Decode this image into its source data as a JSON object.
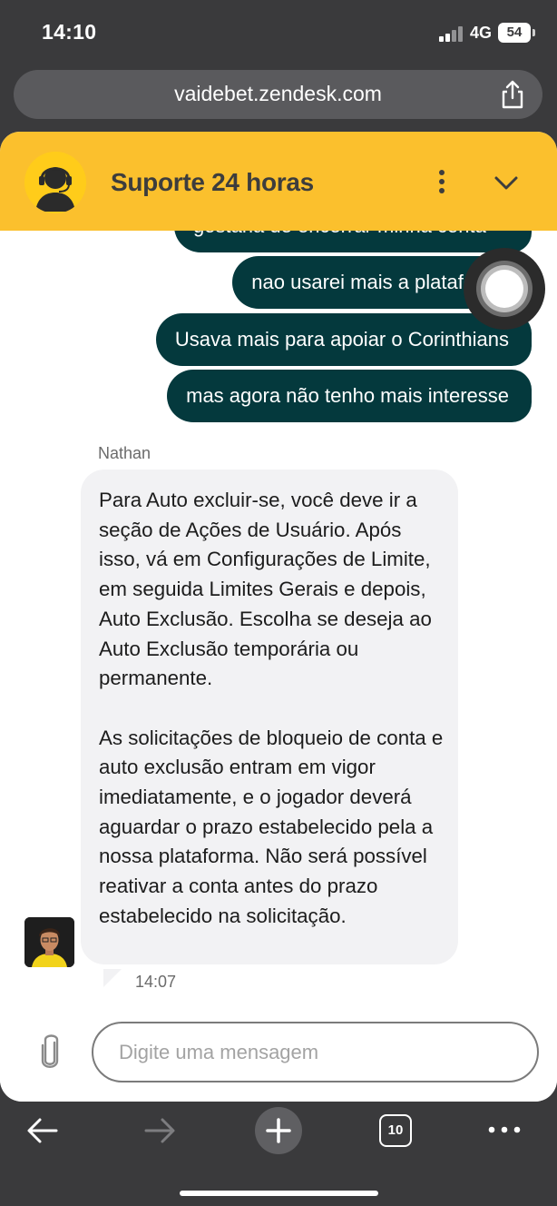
{
  "status_bar": {
    "time": "14:10",
    "network": "4G",
    "battery": "54"
  },
  "browser": {
    "url": "vaidebet.zendesk.com",
    "tab_count": "10"
  },
  "chat": {
    "title": "Suporte 24 horas",
    "outgoing_messages": [
      "gostaria de encerrar minha conta",
      "nao usarei mais a plataforma",
      "Usava mais para apoiar o Corinthians",
      "mas agora não tenho mais interesse"
    ],
    "agent_name": "Nathan",
    "agent_message": "Para Auto excluir-se, você deve ir a seção de Ações de Usuário. Após isso, vá em Configurações de Limite, em seguida Limites Gerais e depois, Auto Exclusão. Escolha se deseja ao Auto Exclusão temporária ou permanente.\n\nAs solicitações de bloqueio de conta e auto exclusão entram em vigor imediatamente, e o jogador deverá aguardar o prazo estabelecido pela a nossa plataforma. Não será possível reativar a conta antes do prazo estabelecido na solicitação.",
    "timestamp": "14:07",
    "input_placeholder": "Digite uma mensagem"
  },
  "colors": {
    "header_bg": "#fbc02d",
    "outgoing_bubble": "#04393d",
    "incoming_bubble": "#f2f2f4",
    "browser_chrome": "#3a3a3c"
  },
  "icons": [
    "share-icon",
    "more-vertical-icon",
    "chevron-down-icon",
    "paperclip-icon",
    "back-arrow-icon",
    "forward-arrow-icon",
    "plus-icon",
    "tabs-icon",
    "more-horizontal-icon"
  ]
}
